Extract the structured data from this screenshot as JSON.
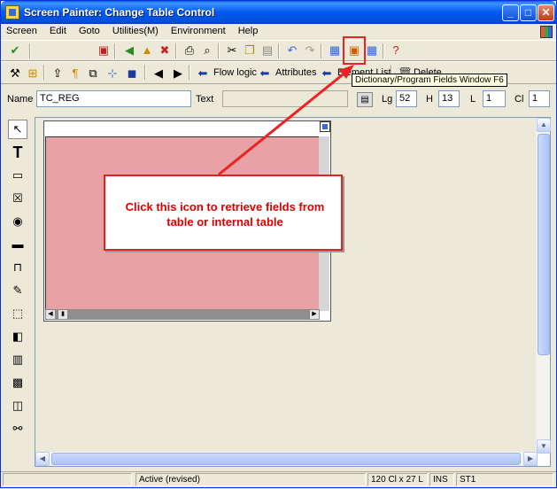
{
  "window": {
    "title": "Screen Painter:  Change Table Control"
  },
  "menu": [
    "Screen",
    "Edit",
    "Goto",
    "Utilities(M)",
    "Environment",
    "Help"
  ],
  "toolbar2": {
    "flow_logic": "Flow logic",
    "attributes": "Attributes",
    "element_list": "Element List",
    "delete": "Delete"
  },
  "tooltip": "Dictionary/Program Fields Window   F6",
  "fields": {
    "name_label": "Name",
    "name_value": "TC_REG",
    "text_label": "Text",
    "text_value": "",
    "lg_label": "Lg",
    "lg_value": "52",
    "h_label": "H",
    "h_value": "13",
    "l_label": "L",
    "l_value": "1",
    "cl_label": "Cl",
    "cl_value": "1"
  },
  "callout": {
    "text": "Click this icon to retrieve fields from table or internal table"
  },
  "status": {
    "message": "",
    "mode": "Active (revised)",
    "size": "120 Cl x 27 L",
    "insert": "INS",
    "s1": "ST1"
  },
  "colors": {
    "table_body": "#e8a1a5",
    "callout": "#dd0000",
    "titlebar": "#0058ee"
  }
}
